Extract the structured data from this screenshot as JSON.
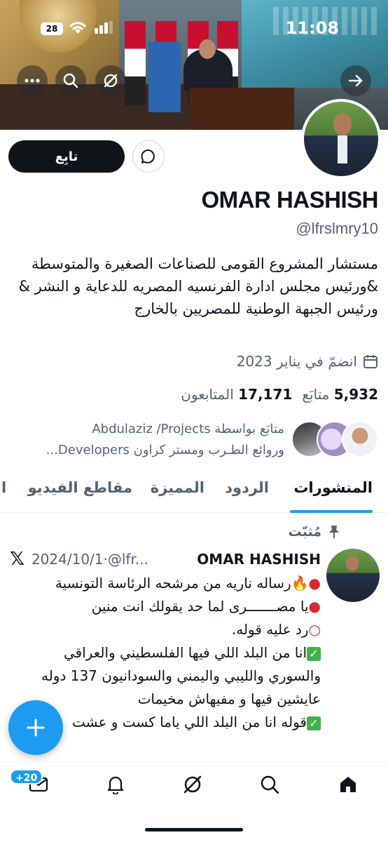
{
  "status_bar": {
    "time": "11:08",
    "battery": "28"
  },
  "profile": {
    "name": "OMAR HASHISH",
    "handle": "@lfrslmry10",
    "bio": "مستشار المشروع القومى للصناعات الصغيرة والمتوسطة &ورئيس مجلس ادارة الفرنسيه المصريه للدعاية و النشر & ورئيس الجبهة الوطنية للمصريين بالخارج",
    "joined": "انضمّ في يناير 2023",
    "following_count": "5,932",
    "following_label": "متابَع",
    "followers_count": "17,171",
    "followers_label": "المتابعون",
    "followed_by_line1": "متابَع بواسطة Abdulaziz /Projects",
    "followed_by_line2": "وروائع الطـرب ومستر كراون Developers..."
  },
  "actions": {
    "follow_label": "تابِع"
  },
  "tabs": [
    {
      "label": "المنشورات",
      "active": true
    },
    {
      "label": "الردود",
      "active": false
    },
    {
      "label": "المميزة",
      "active": false
    },
    {
      "label": "مقاطع الفيديو",
      "active": false
    },
    {
      "label": "ا",
      "active": false
    }
  ],
  "post": {
    "pinned_label": "مُثبّت",
    "author": "OMAR HASHISH",
    "handle_trunc": "@lfr...",
    "date": "2024/10/1",
    "line1": "رساله ناريه من مرشحه الرئاسة التونسية",
    "line2": "يا مصـــــــرى لما حد يقولك انت منين",
    "line3": "رد عليه قوله.",
    "line4": "انا من البلد اللي فيها الفلسطيني والعراقي والسوري والليبي واليمني والسودانيون 137 دوله عايشين فيها و مفيهاش مخيمات",
    "line5": "قوله انا من البلد اللي ياما كست و عشت"
  },
  "fab": {
    "icon": "plus-icon"
  },
  "bottom_nav": {
    "messages_badge": "+20"
  },
  "colors": {
    "accent": "#1d9bf0",
    "text": "#0f1419",
    "muted": "#536471"
  }
}
